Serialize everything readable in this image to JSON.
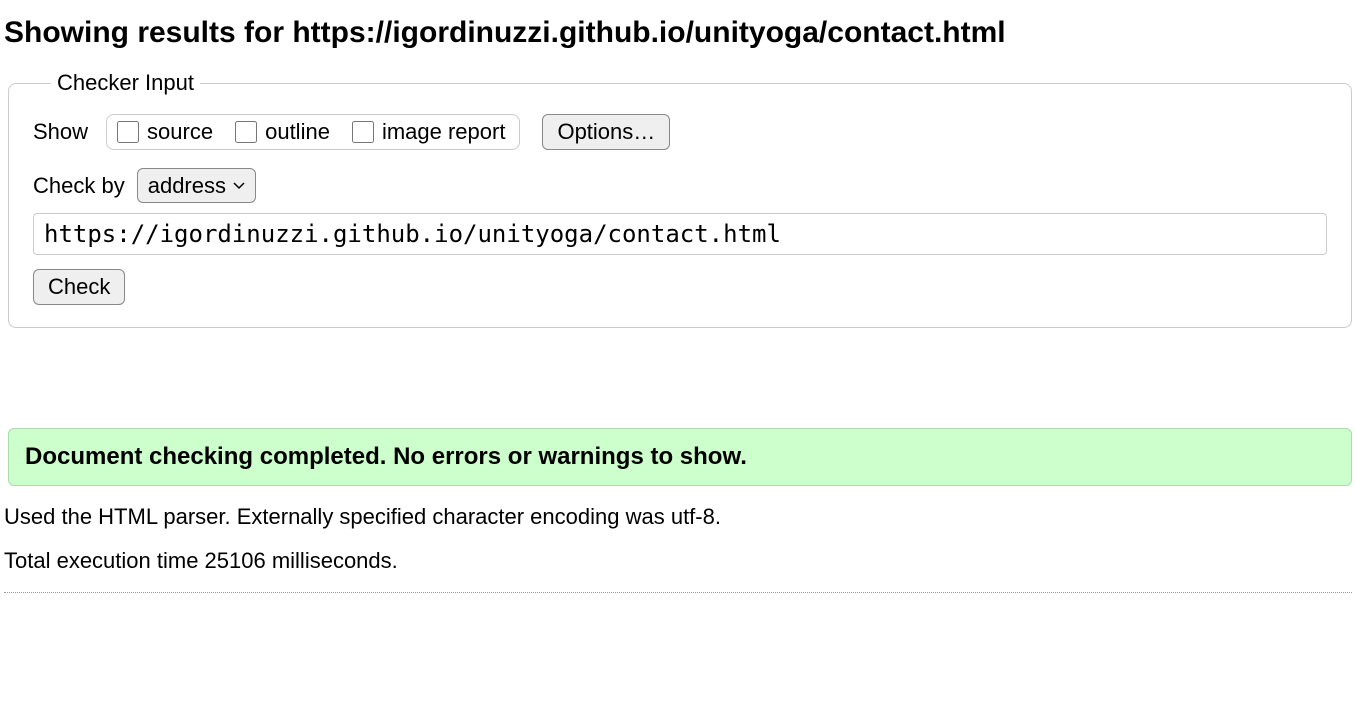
{
  "heading": {
    "prefix": "Showing results for ",
    "url": "https://igordinuzzi.github.io/unityoga/contact.html"
  },
  "fieldset": {
    "legend": "Checker Input",
    "show_label": "Show",
    "checkboxes": {
      "source": "source",
      "outline": "outline",
      "image_report": "image report"
    },
    "options_button": "Options…",
    "check_by_label": "Check by",
    "check_by_select": {
      "selected": "address"
    },
    "url_value": "https://igordinuzzi.github.io/unityoga/contact.html",
    "check_button": "Check"
  },
  "result": {
    "success_message": "Document checking completed. No errors or warnings to show.",
    "parser_line": "Used the HTML parser. Externally specified character encoding was utf-8.",
    "time_line": "Total execution time 25106 milliseconds."
  }
}
